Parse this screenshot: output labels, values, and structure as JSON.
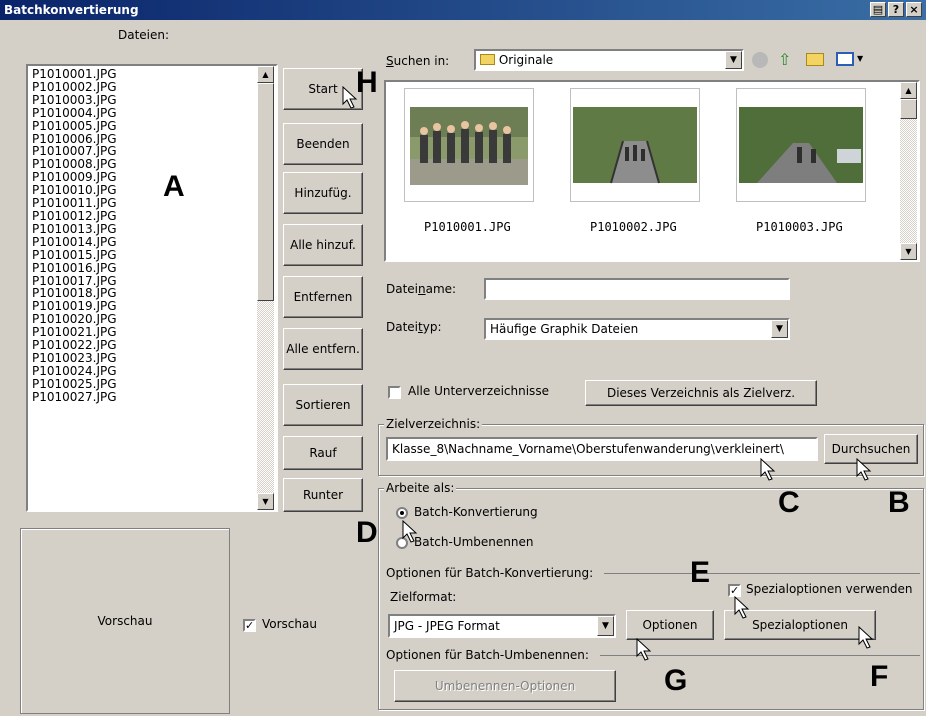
{
  "window": {
    "title": "Batchkonvertierung",
    "help": "?",
    "close": "×"
  },
  "files": {
    "label": "Dateien:",
    "items": [
      "P1010001.JPG",
      "P1010002.JPG",
      "P1010003.JPG",
      "P1010004.JPG",
      "P1010005.JPG",
      "P1010006.JPG",
      "P1010007.JPG",
      "P1010008.JPG",
      "P1010009.JPG",
      "P1010010.JPG",
      "P1010011.JPG",
      "P1010012.JPG",
      "P1010013.JPG",
      "P1010014.JPG",
      "P1010015.JPG",
      "P1010016.JPG",
      "P1010017.JPG",
      "P1010018.JPG",
      "P1010019.JPG",
      "P1010020.JPG",
      "P1010021.JPG",
      "P1010022.JPG",
      "P1010023.JPG",
      "P1010024.JPG",
      "P1010025.JPG",
      "P1010027.JPG"
    ]
  },
  "buttons": {
    "start": "Start",
    "beenden": "Beenden",
    "hinzufuegen": "Hinzufüg.",
    "alle_hinzu": "Alle hinzuf.",
    "entfernen": "Entfernen",
    "alle_entfernen": "Alle entfern.",
    "sortieren": "Sortieren",
    "rauf": "Rauf",
    "runter": "Runter"
  },
  "preview": {
    "box_label": "Vorschau",
    "checkbox_label": "Vorschau",
    "checked": true
  },
  "browser": {
    "search_label_u": "S",
    "search_label_rest": "uchen in:",
    "folder": "Originale",
    "thumbnails": [
      "P1010001.JPG",
      "P1010002.JPG",
      "P1010003.JPG"
    ],
    "filename_label_a": "Datei",
    "filename_label_u": "n",
    "filename_label_b": "ame:",
    "filename_value": "",
    "filetype_label_a": "Datei",
    "filetype_label_u": "t",
    "filetype_label_b": "yp:",
    "filetype_value": "Häufige Graphik Dateien",
    "subdirs_label": "Alle Unterverzeichnisse",
    "set_target_button": "Dieses Verzeichnis als Zielverz."
  },
  "target": {
    "group_label": "Zielverzeichnis:",
    "path": "Klasse_8\\Nachname_Vorname\\Oberstufenwanderung\\verkleinert\\",
    "browse_button": "Durchsuchen"
  },
  "work": {
    "group_label": "Arbeite als:",
    "radio_convert": "Batch-Konvertierung",
    "radio_rename": "Batch-Umbenennen"
  },
  "convert_options": {
    "group_label": "Optionen für Batch-Konvertierung:",
    "special_checkbox": "Spezialoptionen verwenden",
    "format_label": "Zielformat:",
    "format_value": "JPG - JPEG Format",
    "options_button": "Optionen",
    "special_button": "Spezialoptionen"
  },
  "rename_options": {
    "group_label": "Optionen für Batch-Umbenennen:",
    "rename_button": "Umbenennen-Optionen"
  },
  "annotations": {
    "a": "A",
    "b": "B",
    "c": "C",
    "d": "D",
    "e": "E",
    "f": "F",
    "g": "G",
    "h": "H"
  },
  "colors": {
    "title_start": "#0a246a",
    "title_end": "#3a6ea5",
    "face": "#d4d0c8"
  }
}
